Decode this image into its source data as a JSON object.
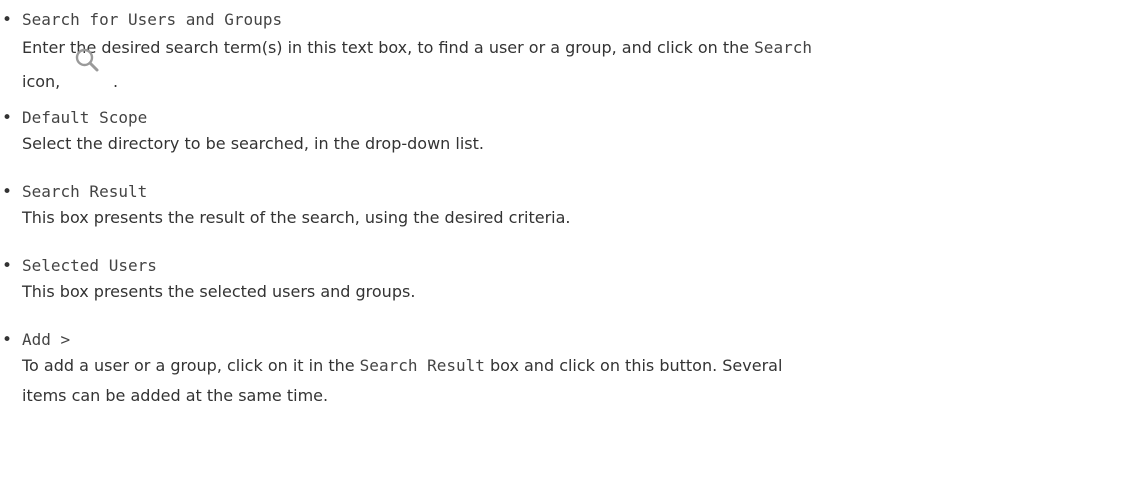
{
  "items": [
    {
      "term": "Search for Users and Groups",
      "desc_before": "Enter the desired search term(s) in this text box, to find a user or a group, and click on the ",
      "desc_code": "Search",
      "desc_icon_label": "icon,",
      "desc_after": "."
    },
    {
      "term": "Default Scope",
      "desc": "Select the directory to be searched, in the drop-down list."
    },
    {
      "term": "Search Result",
      "desc": "This box presents the result of the search, using the desired criteria."
    },
    {
      "term": "Selected Users",
      "desc": "This box presents the selected users and groups."
    },
    {
      "term": "Add >",
      "desc_before": "To add a user or a group, click on it in the ",
      "desc_code": "Search Result",
      "desc_line1_after": " box and click on this button. Several",
      "desc_line2": "items can be added at the same time."
    }
  ],
  "icons": {
    "search": "search-icon",
    "bullet": "•"
  },
  "colors": {
    "text": "#333333",
    "code": "#444444",
    "icon": "#9a9a9a"
  }
}
